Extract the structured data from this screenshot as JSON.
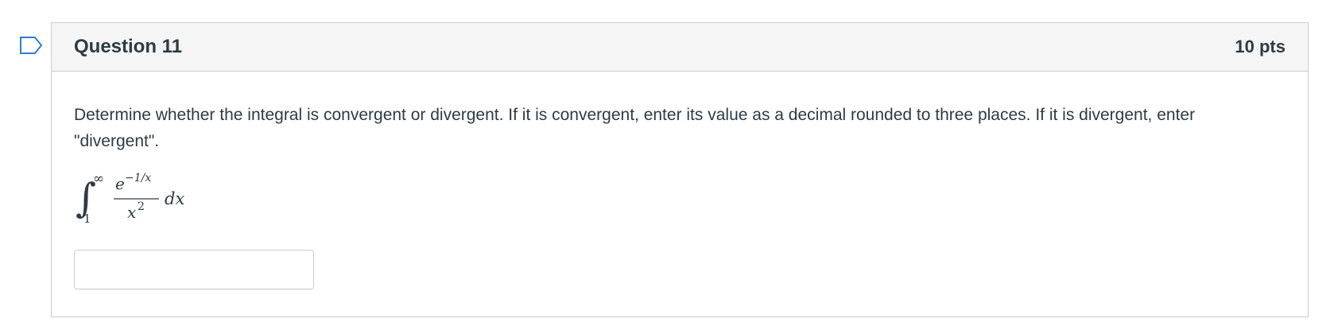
{
  "question": {
    "title": "Question 11",
    "points": "10 pts",
    "text": "Determine whether the integral is convergent or divergent. If it is convergent, enter its value as a decimal rounded to three places. If it is divergent, enter \"divergent\".",
    "math": {
      "integral_sign": "∫",
      "upper_limit": "∞",
      "lower_limit": "1",
      "numerator_base": "e",
      "numerator_exponent": "−1/x",
      "denominator_base": "x",
      "denominator_exponent": "2",
      "differential": "dx"
    },
    "answer": {
      "value": "",
      "placeholder": ""
    }
  },
  "colors": {
    "border": "#c7cdd1",
    "header_bg": "#f5f5f5",
    "text": "#2d3b45",
    "flag": "#2d7fcf"
  },
  "icons": {
    "flag": "flag-outline-icon"
  }
}
